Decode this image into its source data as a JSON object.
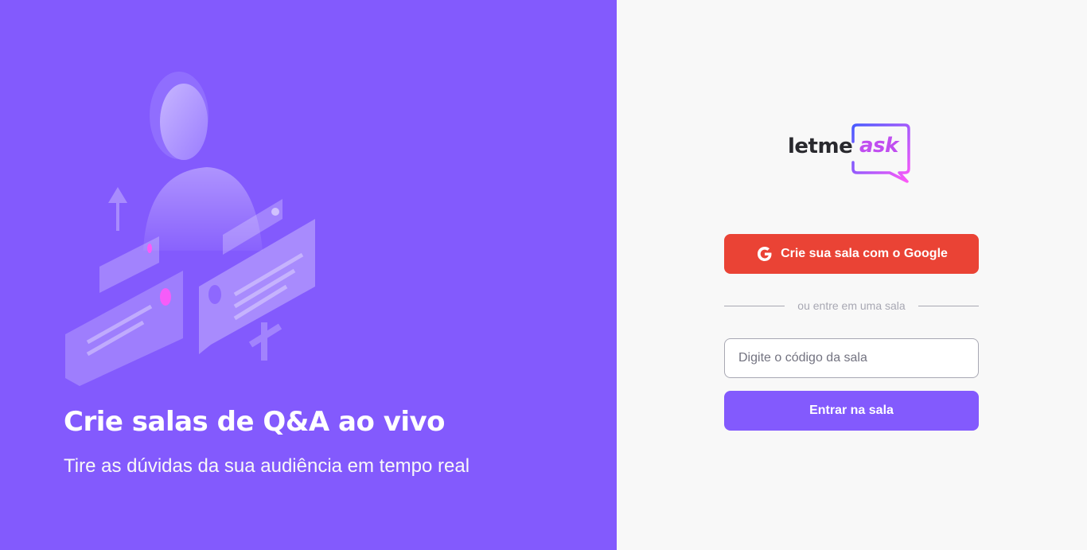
{
  "aside": {
    "headline": "Crie salas de Q&A ao vivo",
    "subline": "Tire as dúvidas da sua audiência em tempo real",
    "illustration_icon": "qa-illustration"
  },
  "logo": {
    "word_left": "letme",
    "word_right": "ask"
  },
  "google_button": {
    "label": "Crie sua sala com o Google",
    "icon": "google-icon"
  },
  "separator": {
    "text": "ou entre em uma sala"
  },
  "room_input": {
    "placeholder": "Digite o código da sala",
    "value": ""
  },
  "enter_button": {
    "label": "Entrar na sala"
  },
  "colors": {
    "brand": "#835afd",
    "google": "#ea4335",
    "background": "#f8f8f8",
    "text_dark": "#29292e",
    "muted": "#a8a8b3",
    "logo_gradient_start": "#485bff",
    "logo_gradient_end": "#ff59f8"
  }
}
